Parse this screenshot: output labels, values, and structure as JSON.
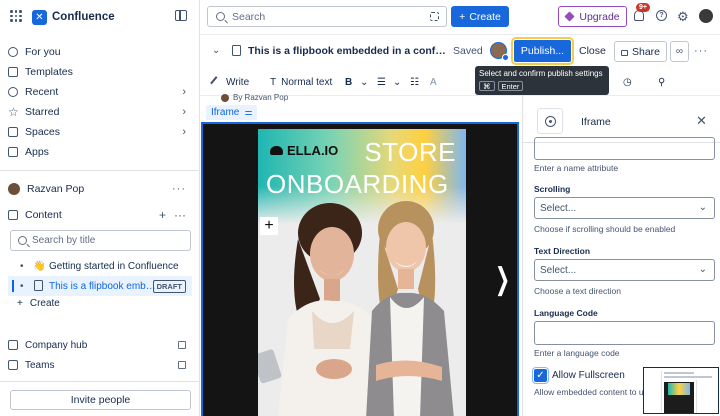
{
  "sidebar": {
    "brand": "Confluence",
    "nav": [
      {
        "label": "For you"
      },
      {
        "label": "Templates"
      },
      {
        "label": "Recent"
      },
      {
        "label": "Starred"
      },
      {
        "label": "Spaces"
      },
      {
        "label": "Apps"
      }
    ],
    "user": "Razvan Pop",
    "content_label": "Content",
    "search_placeholder": "Search by title",
    "tree": [
      {
        "label": "Getting started in Confluence",
        "emoji": "👋"
      },
      {
        "label": "This is a flipbook emb…",
        "badge": "DRAFT"
      }
    ],
    "create_label": "Create",
    "links": [
      {
        "label": "Company hub"
      },
      {
        "label": "Teams"
      }
    ],
    "invite_label": "Invite people"
  },
  "topbar": {
    "search_placeholder": "Search",
    "create_label": "Create",
    "upgrade_label": "Upgrade",
    "notif_badge": "9+"
  },
  "page": {
    "title": "This is a flipbook embedded in a confluence page",
    "status": "Saved",
    "publish_label": "Publish...",
    "close_label": "Close",
    "share_label": "Share",
    "tooltip": {
      "text": "Select and confirm publish settings",
      "key1": "⌘",
      "key2": "Enter"
    },
    "toolbar": {
      "write_label": "Write",
      "style_label": "Normal text"
    },
    "byline": "By Razvan Pop",
    "tag": "Iframe"
  },
  "flipbook": {
    "brand": "ELLA.IO",
    "headline1": "STORE",
    "headline2": "ONBOARDING"
  },
  "panel": {
    "title": "Iframe",
    "name_hint": "Enter a name attribute",
    "scrolling_label": "Scrolling",
    "scrolling_value": "Select...",
    "scrolling_hint": "Choose if scrolling should be enabled",
    "direction_label": "Text Direction",
    "direction_value": "Select...",
    "direction_hint": "Choose a text direction",
    "language_label": "Language Code",
    "language_hint": "Enter a language code",
    "fullscreen_label": "Allow Fullscreen",
    "fullscreen_hint": "Allow embedded content to use"
  }
}
